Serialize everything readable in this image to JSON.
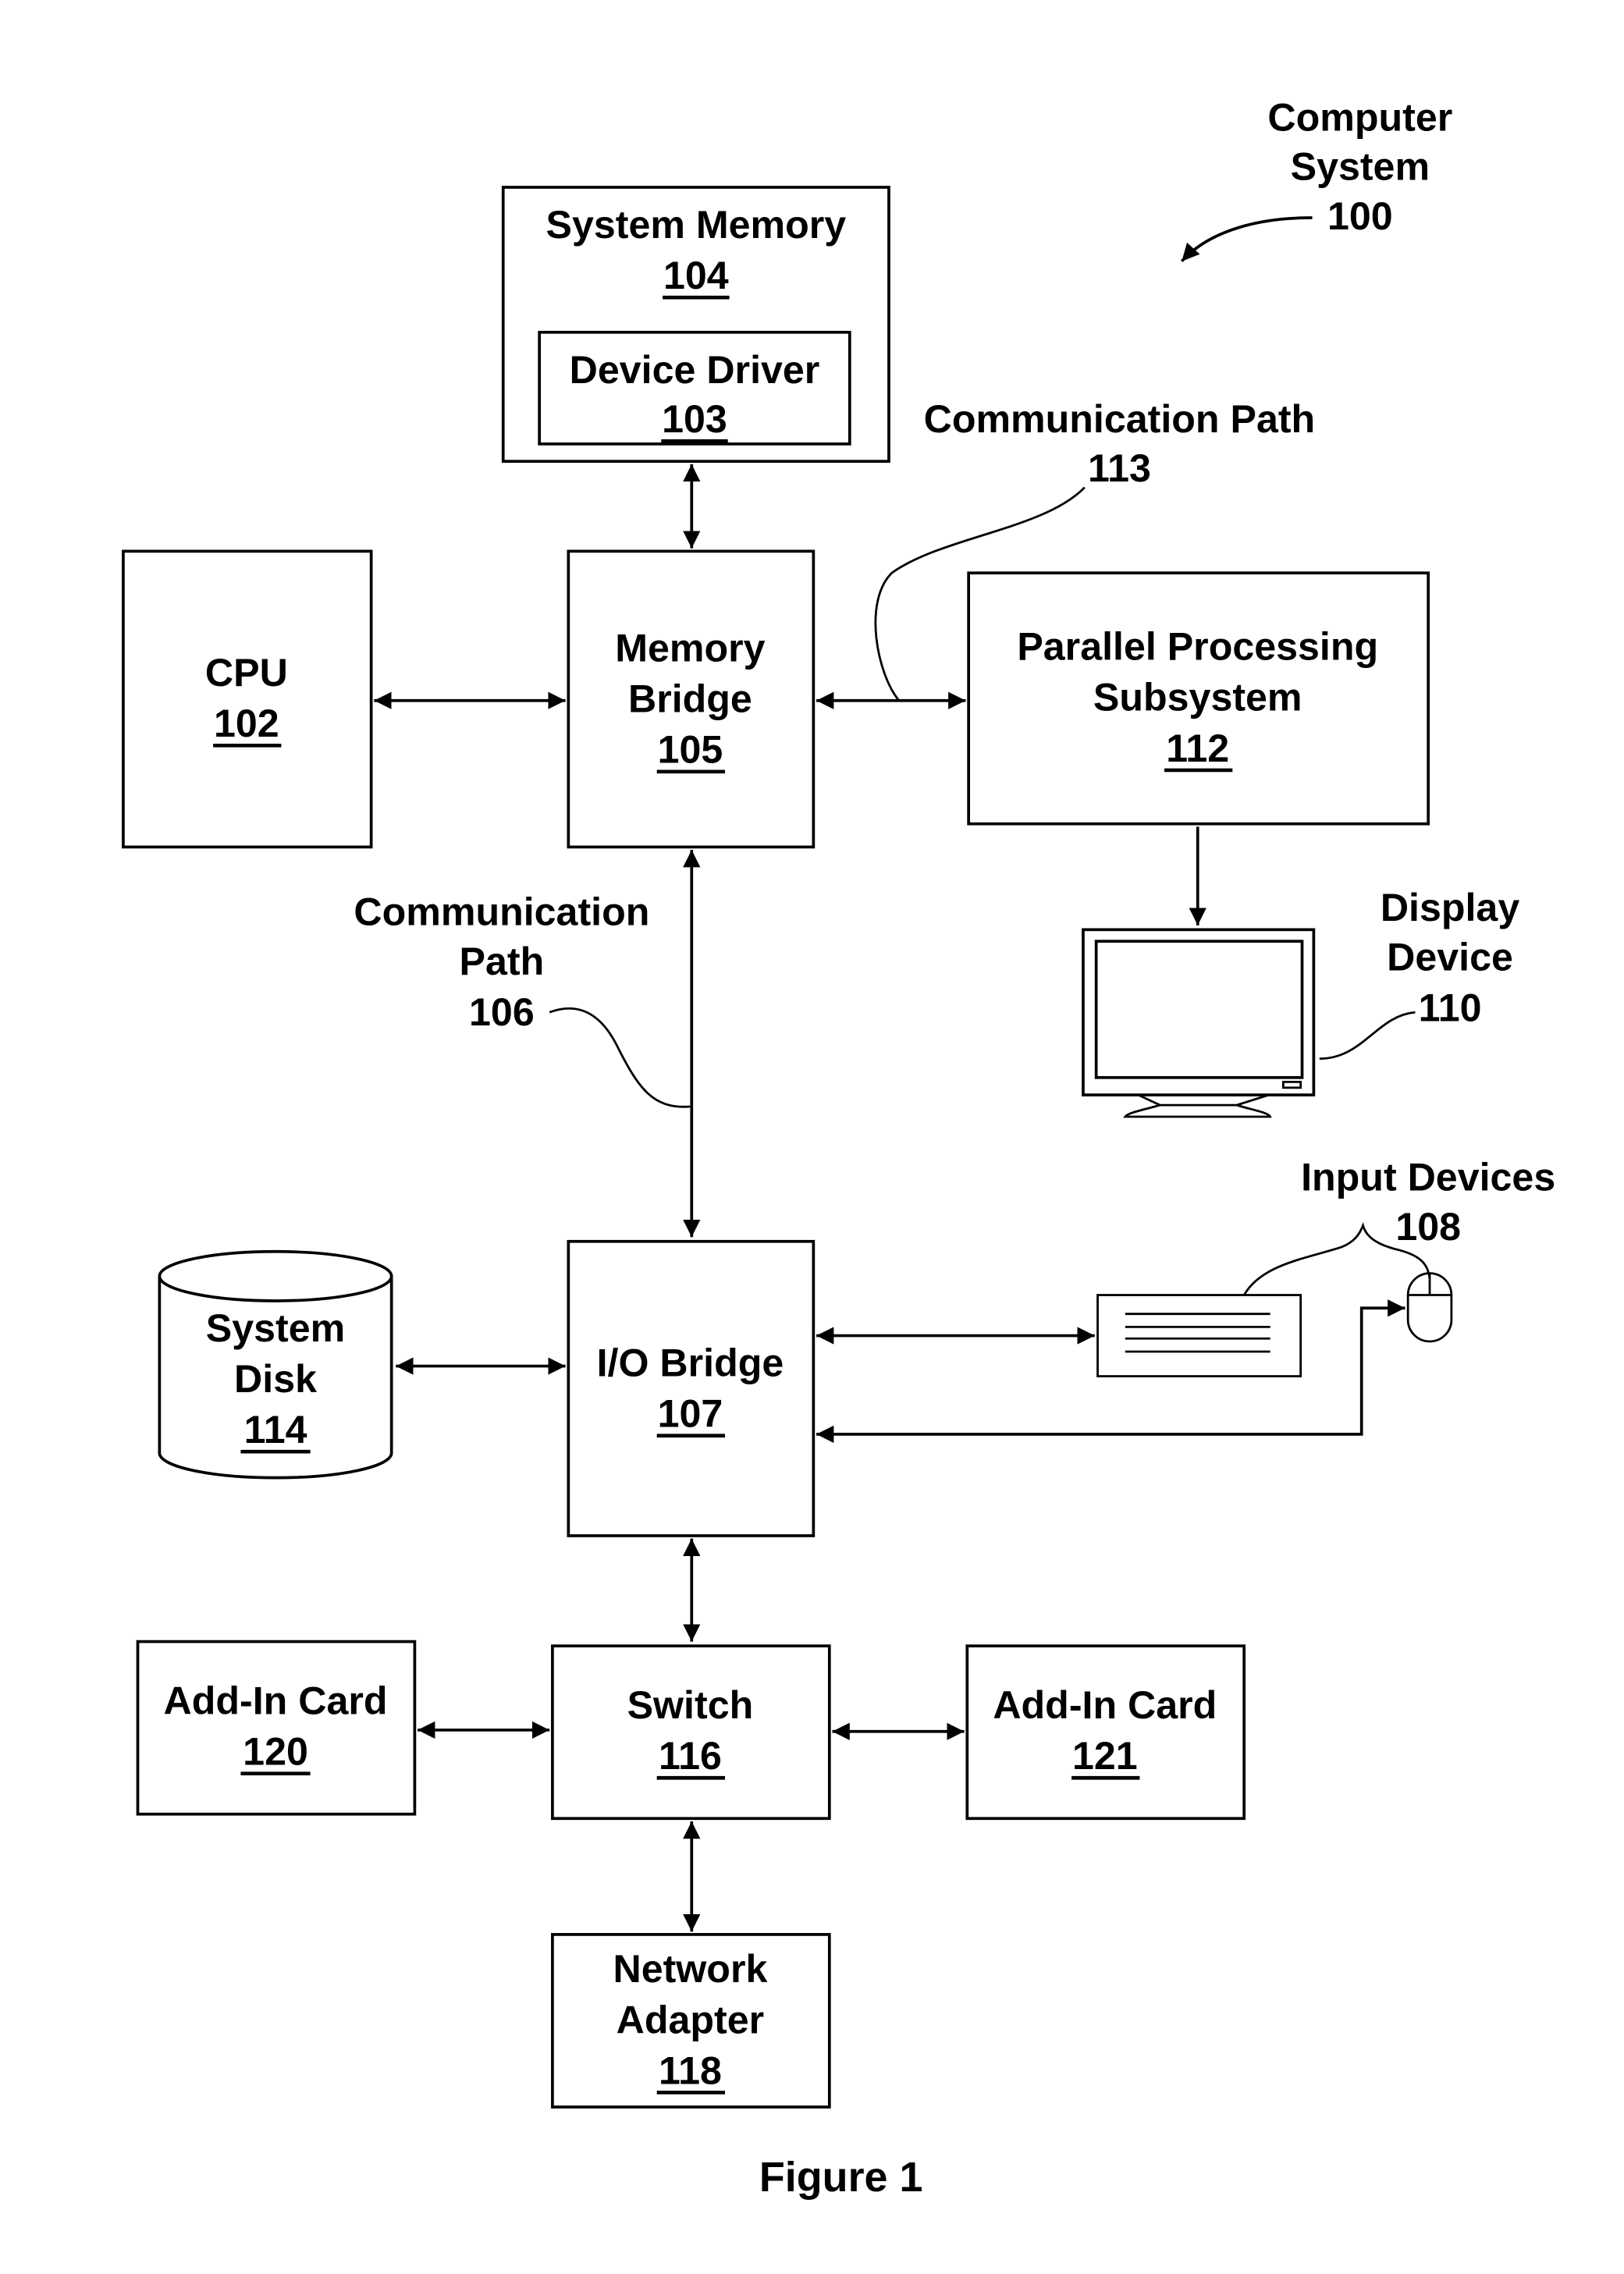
{
  "title": {
    "line1": "Computer",
    "line2": "System",
    "ref": "100"
  },
  "figure_caption": "Figure 1",
  "components": {
    "system_memory": {
      "label": "System Memory",
      "ref": "104"
    },
    "device_driver": {
      "label": "Device Driver",
      "ref": "103"
    },
    "cpu": {
      "label": "CPU",
      "ref": "102"
    },
    "memory_bridge": {
      "line1": "Memory",
      "line2": "Bridge",
      "ref": "105"
    },
    "parallel_processing": {
      "line1": "Parallel Processing",
      "line2": "Subsystem",
      "ref": "112"
    },
    "display_device": {
      "line1": "Display",
      "line2": "Device",
      "ref": "110"
    },
    "input_devices": {
      "label": "Input Devices",
      "ref": "108"
    },
    "system_disk": {
      "line1": "System",
      "line2": "Disk",
      "ref": "114"
    },
    "io_bridge": {
      "label": "I/O Bridge",
      "ref": "107"
    },
    "add_in_card_120": {
      "label": "Add-In Card",
      "ref": "120"
    },
    "switch": {
      "label": "Switch",
      "ref": "116"
    },
    "add_in_card_121": {
      "label": "Add-In Card",
      "ref": "121"
    },
    "network_adapter": {
      "line1": "Network",
      "line2": "Adapter",
      "ref": "118"
    }
  },
  "paths": {
    "path_113": {
      "label": "Communication Path",
      "ref": "113"
    },
    "path_106": {
      "line1": "Communication",
      "line2": "Path",
      "ref": "106"
    }
  }
}
